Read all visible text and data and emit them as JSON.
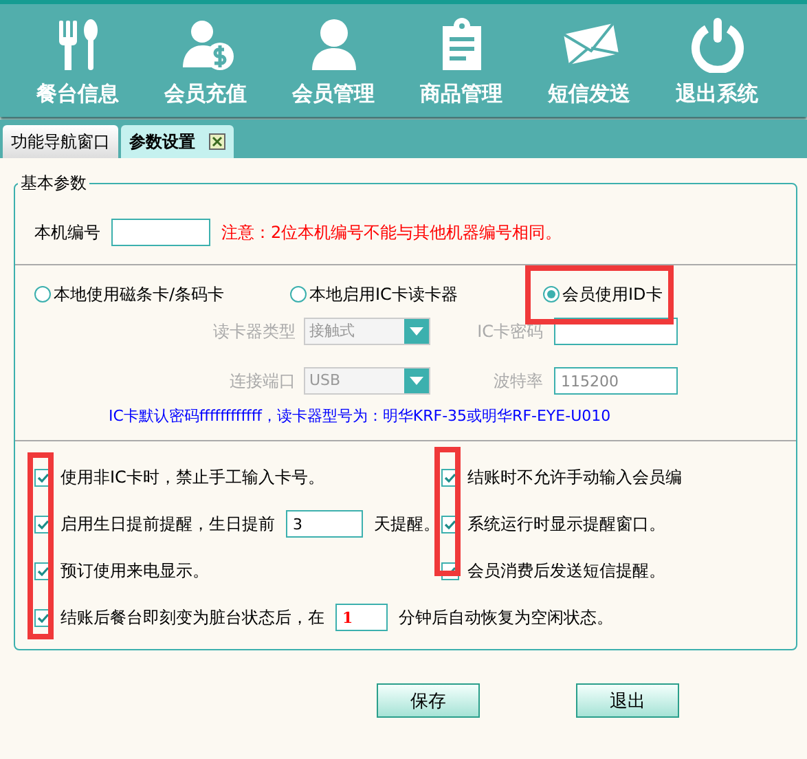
{
  "toolbar": [
    {
      "label": "餐台信息"
    },
    {
      "label": "会员充值"
    },
    {
      "label": "会员管理"
    },
    {
      "label": "商品管理"
    },
    {
      "label": "短信发送"
    },
    {
      "label": "退出系统"
    }
  ],
  "tabs": [
    {
      "label": "功能导航窗口",
      "selected": false
    },
    {
      "label": "参数设置",
      "selected": true
    }
  ],
  "group": {
    "title": "基本参数",
    "machine_no": {
      "label": "本机编号",
      "note": "注意：2位本机编号不能与其他机器编号相同。"
    },
    "card_modes": [
      {
        "label": "本地使用磁条卡/条码卡",
        "selected": false,
        "highlighted": false
      },
      {
        "label": "本地启用IC卡读卡器",
        "selected": false,
        "highlighted": false
      },
      {
        "label": "会员使用ID卡",
        "selected": true,
        "highlighted": true
      }
    ],
    "reader_fields": [
      {
        "label": "读卡器类型",
        "kind": "dropdown",
        "value": "接触式",
        "disabled": true
      },
      {
        "label": "IC卡密码",
        "kind": "text",
        "disabled": true
      },
      {
        "label": "连接端口",
        "kind": "dropdown",
        "value": "USB",
        "disabled": true
      },
      {
        "label": "波特率",
        "kind": "text",
        "value": "115200",
        "disabled": true
      }
    ],
    "reader_note": "IC卡默认密码ffffffffffff，读卡器型号为：明华KRF-35或明华RF-EYE-U010",
    "option_columns": [
      {
        "highlighted": true,
        "items": [
          {
            "kind": "plain",
            "label": "使用非IC卡时，禁止手工输入卡号。",
            "checked": true
          },
          {
            "kind": "inline_input",
            "before": "启用生日提前提醒，生日提前",
            "value": "3",
            "after": "天提醒。",
            "emphasis": false,
            "checked": true
          },
          {
            "kind": "plain",
            "label": "预订使用来电显示。",
            "checked": true
          },
          {
            "kind": "inline_input",
            "before": "结账后餐台即刻变为脏台状态后，在",
            "value": "1",
            "after": "分钟后自动恢复为空闲状态。",
            "emphasis": true,
            "checked": true
          }
        ]
      },
      {
        "highlighted": true,
        "items": [
          {
            "kind": "plain",
            "label": "结账时不允许手动输入会员编",
            "checked": true
          },
          {
            "kind": "plain",
            "label": "系统运行时显示提醒窗口。",
            "checked": true
          },
          {
            "kind": "plain",
            "label": "会员消费后发送短信提醒。",
            "checked": true
          }
        ]
      }
    ]
  },
  "buttons": [
    "保存",
    "退出"
  ]
}
